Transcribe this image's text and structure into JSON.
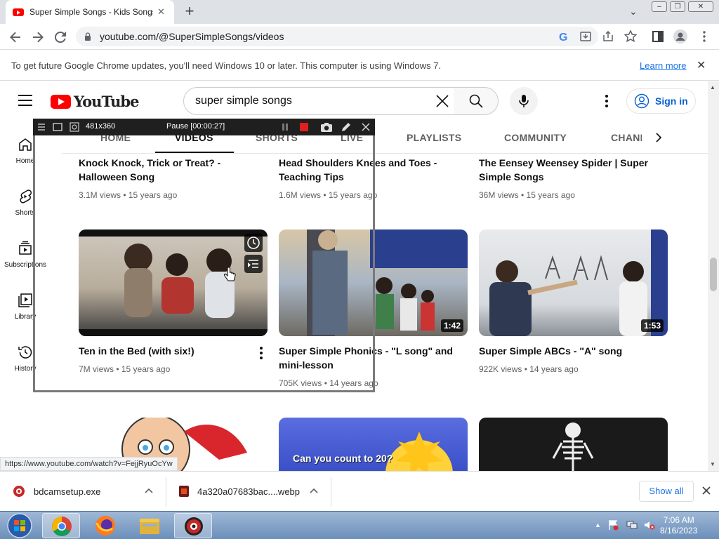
{
  "browser": {
    "tab_title": "Super Simple Songs - Kids Songs",
    "new_tab": "+",
    "url": "youtube.com/@SuperSimpleSongs/videos",
    "update_message": "To get future Google Chrome updates, you'll need Windows 10 or later. This computer is using Windows 7.",
    "learn_more": "Learn more",
    "status_url": "https://www.youtube.com/watch?v=FejjRyuOcYw"
  },
  "youtube": {
    "logo_text": "YouTube",
    "search_value": "super simple songs",
    "sign_in": "Sign in",
    "rail": [
      {
        "label": "Home"
      },
      {
        "label": "Shorts"
      },
      {
        "label": "Subscriptions"
      },
      {
        "label": "Library"
      },
      {
        "label": "History"
      }
    ],
    "tabs": [
      "HOME",
      "VIDEOS",
      "SHORTS",
      "LIVE",
      "PLAYLISTS",
      "COMMUNITY",
      "CHANNELS"
    ],
    "videos_row1": [
      {
        "title": "Knock Knock, Trick or Treat? - Halloween Song",
        "meta": "3.1M views • 15 years ago"
      },
      {
        "title": "Head Shoulders Knees and Toes - Teaching Tips",
        "meta": "1.6M views • 15 years ago"
      },
      {
        "title": "The Eensey Weensey Spider | Super Simple Songs",
        "meta": "36M views • 15 years ago"
      }
    ],
    "videos_row2": [
      {
        "title": "Ten in the Bed (with six!)",
        "meta": "7M views • 15 years ago",
        "duration": ""
      },
      {
        "title": "Super Simple Phonics - \"L song\" and mini-lesson",
        "meta": "705K views • 14 years ago",
        "duration": "1:42"
      },
      {
        "title": "Super Simple ABCs - \"A\" song",
        "meta": "922K views • 14 years ago",
        "duration": "1:53"
      }
    ],
    "row3_thumb_text": "Can you count to 20?"
  },
  "bandicam": {
    "size": "481x360",
    "status": "Pause [00:00:27]"
  },
  "downloads": {
    "items": [
      "bdcamsetup.exe",
      "4a320a07683bac....webp"
    ],
    "show_all": "Show all"
  },
  "taskbar": {
    "time": "7:06 AM",
    "date": "8/16/2023"
  }
}
